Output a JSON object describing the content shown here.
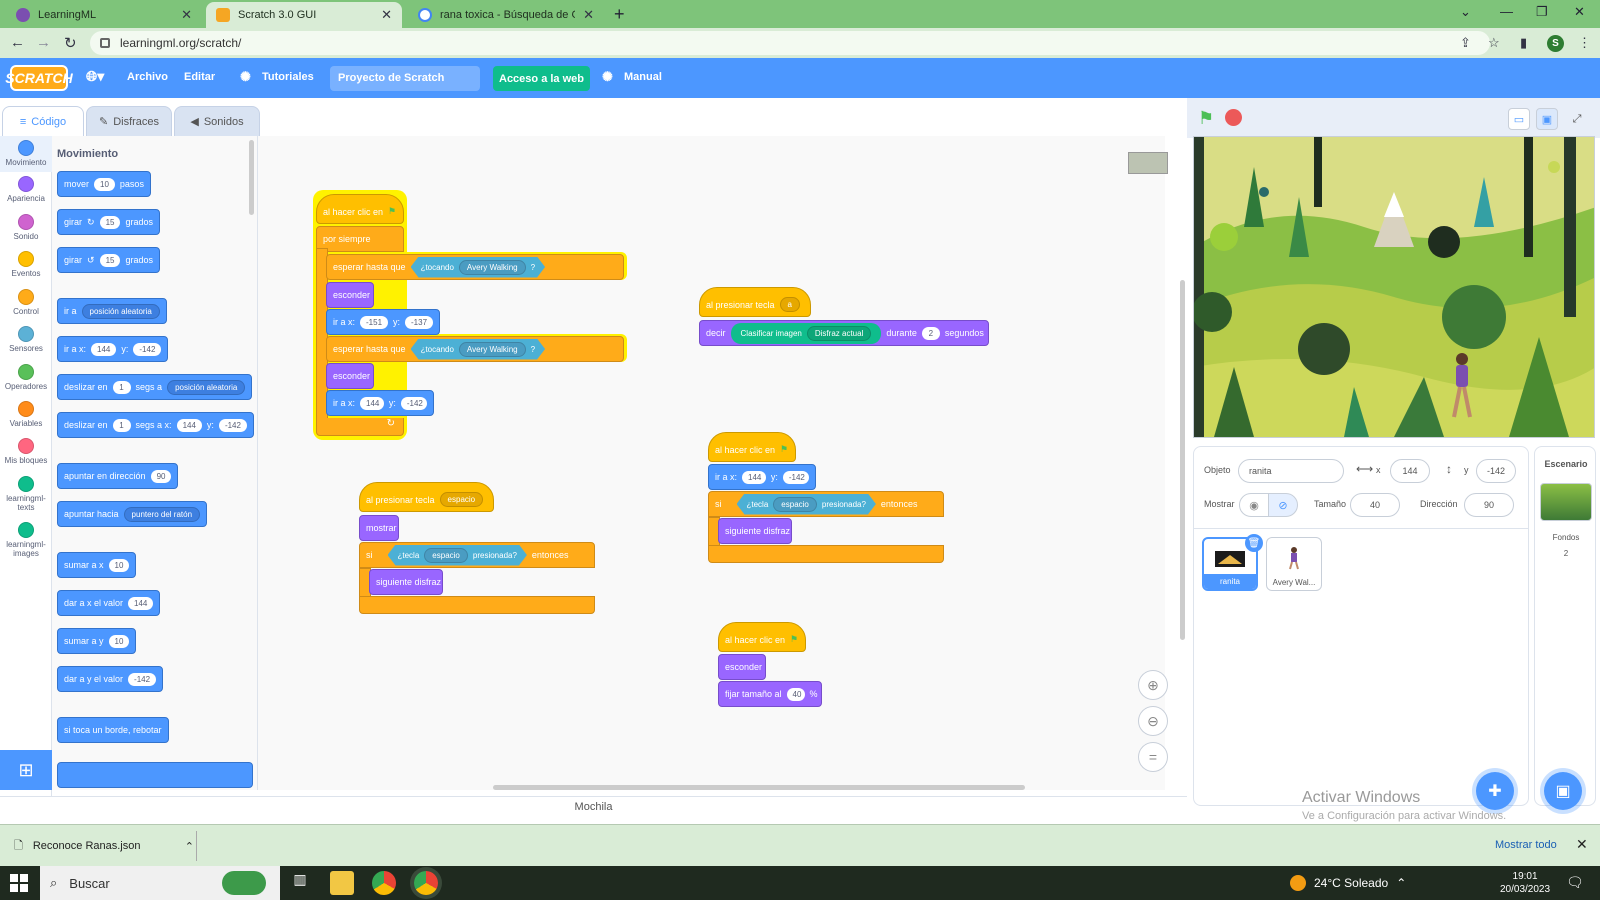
{
  "browser": {
    "tabs": [
      {
        "title": "LearningML"
      },
      {
        "title": "Scratch 3.0 GUI"
      },
      {
        "title": "rana toxica - Búsqueda de Googl"
      }
    ],
    "url": "learningml.org/scratch/",
    "profile_initial": "S"
  },
  "menu": {
    "logo": "SCRATCH",
    "file": "Archivo",
    "edit": "Editar",
    "tutorials": "Tutoriales",
    "project_name": "Proyecto de Scratch",
    "share": "Acceso a la web",
    "manual": "Manual"
  },
  "editor_tabs": {
    "code": "Código",
    "costumes": "Disfraces",
    "sounds": "Sonidos"
  },
  "categories": [
    {
      "label": "Movimiento",
      "color": "#4c97ff"
    },
    {
      "label": "Apariencia",
      "color": "#9966ff"
    },
    {
      "label": "Sonido",
      "color": "#cf63cf"
    },
    {
      "label": "Eventos",
      "color": "#ffbf00"
    },
    {
      "label": "Control",
      "color": "#ffab19"
    },
    {
      "label": "Sensores",
      "color": "#5cb1d6"
    },
    {
      "label": "Operadores",
      "color": "#59c059"
    },
    {
      "label": "Variables",
      "color": "#ff8c1a"
    },
    {
      "label": "Mis bloques",
      "color": "#ff6680"
    },
    {
      "label": "learningml-texts",
      "color": "#0fbd8c"
    },
    {
      "label": "learningml-images",
      "color": "#0fbd8c"
    }
  ],
  "palette": {
    "title": "Movimiento",
    "move": "mover",
    "move_val": "10",
    "steps": "pasos",
    "turn": "girar",
    "turn_val": "15",
    "degrees": "grados",
    "goto": "ir a",
    "goto_dd": "posición aleatoria",
    "gotoxy": "ir a x:",
    "x": "144",
    "y_lbl": "y:",
    "y": "-142",
    "glide": "deslizar en",
    "glide_val": "1",
    "secs_to": "segs a",
    "secs_to_x": "segs a x:",
    "point": "apuntar en dirección",
    "point_val": "90",
    "point_towards": "apuntar hacia",
    "point_towards_dd": "puntero del ratón",
    "change_x": "sumar a x",
    "change_val": "10",
    "set_x": "dar a x el valor",
    "change_y": "sumar a y",
    "set_y": "dar a y el valor",
    "bounce": "si toca un borde, rebotar"
  },
  "script1": {
    "hat": "al hacer clic en",
    "forever": "por siempre",
    "wait_until": "esperar hasta que",
    "touching": "¿tocando",
    "touching_dd": "Avery Walking",
    "q": "?",
    "hide": "esconder",
    "goto": "ir a x:",
    "x1": "-151",
    "y_lbl": "y:",
    "y1": "-137",
    "x2": "144",
    "y2": "-142"
  },
  "script2": {
    "hat": "al presionar tecla",
    "key": "a",
    "say": "decir",
    "classify": "Clasificar imagen",
    "costume": "Disfraz actual",
    "for": "durante",
    "secs": "2",
    "seconds": "segundos"
  },
  "script3": {
    "hat": "al presionar tecla",
    "key": "espacio",
    "show": "mostrar",
    "if": "si",
    "key_pressed": "¿tecla",
    "pressed": "presionada?",
    "then": "entonces",
    "next_costume": "siguiente disfraz"
  },
  "script4": {
    "hat": "al hacer clic en",
    "goto": "ir a x:",
    "x": "144",
    "y_lbl": "y:",
    "y": "-142",
    "if": "si",
    "key_pressed": "¿tecla",
    "key": "espacio",
    "pressed": "presionada?",
    "then": "entonces",
    "next_costume": "siguiente disfraz"
  },
  "script5": {
    "hat": "al hacer clic en",
    "hide": "esconder",
    "size": "fijar tamaño al",
    "size_val": "40",
    "pct": "%"
  },
  "backpack": "Mochila",
  "sprite_info": {
    "sprite_label": "Objeto",
    "sprite_name": "ranita",
    "x_lbl": "x",
    "x": "144",
    "y_lbl": "y",
    "y": "-142",
    "show_lbl": "Mostrar",
    "size_lbl": "Tamaño",
    "size": "40",
    "dir_lbl": "Dirección",
    "dir": "90"
  },
  "sprites": [
    {
      "name": "ranita"
    },
    {
      "name": "Avery Wal..."
    }
  ],
  "stage_pane": {
    "title": "Escenario",
    "backdrops_lbl": "Fondos",
    "backdrops": "2"
  },
  "watermark": {
    "line1": "Activar Windows",
    "line2": "Ve a Configuración para activar Windows."
  },
  "downloads": {
    "file": "Reconoce Ranas.json",
    "show_all": "Mostrar todo"
  },
  "taskbar": {
    "search": "Buscar",
    "weather": "24°C  Soleado",
    "time": "19:01",
    "date": "20/03/2023"
  }
}
